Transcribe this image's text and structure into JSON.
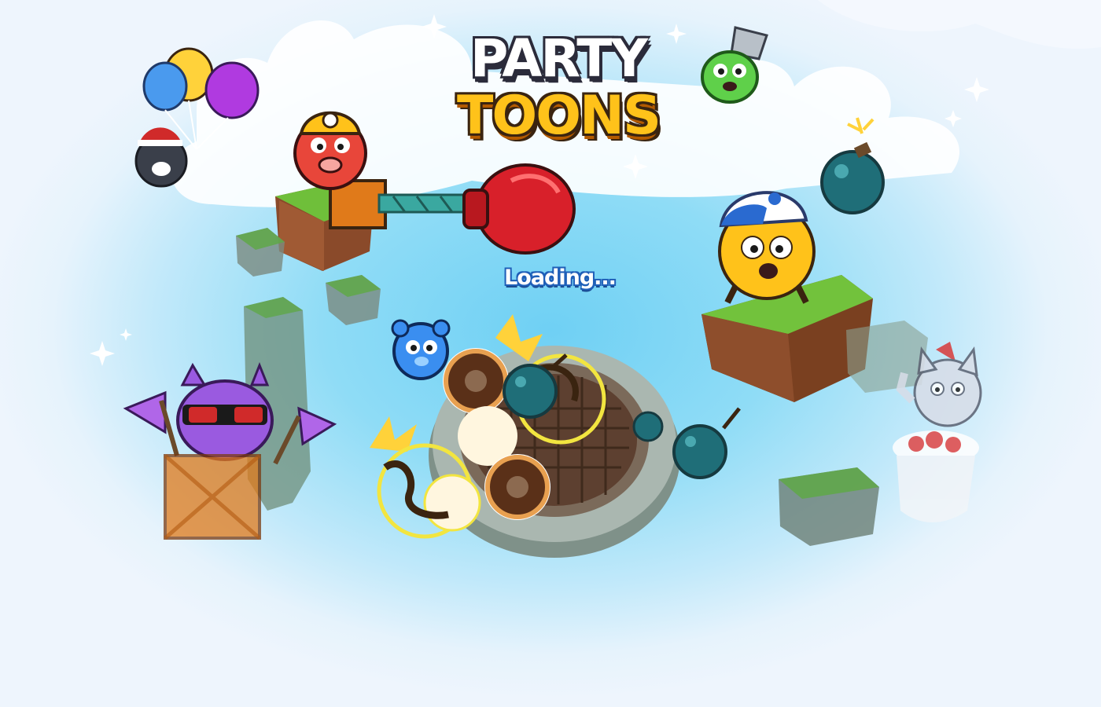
{
  "game": {
    "title_line1": "PARTY",
    "title_line2": "TOONS",
    "status_text": "Loading..."
  },
  "palette": {
    "sky": "#6fd0f4",
    "fog": "#eef5fd",
    "grass": "#6fbf3a",
    "dirt": "#8a4a2a",
    "bomb": "#1f6e78",
    "title_yellow": "#ffc21a",
    "loading_blue": "#1f5fb8"
  },
  "characters": [
    {
      "name": "balloon-cat",
      "color": "#3a3f4a"
    },
    {
      "name": "miner-pig",
      "color": "#e8463a"
    },
    {
      "name": "bucket-frog",
      "color": "#5fd04a"
    },
    {
      "name": "cap-cat",
      "color": "#ffc21a"
    },
    {
      "name": "blue-bear",
      "color": "#3a8ef0"
    },
    {
      "name": "purple-cat",
      "color": "#9a5ae0"
    },
    {
      "name": "punk-cat",
      "color": "#d8dde8"
    }
  ]
}
